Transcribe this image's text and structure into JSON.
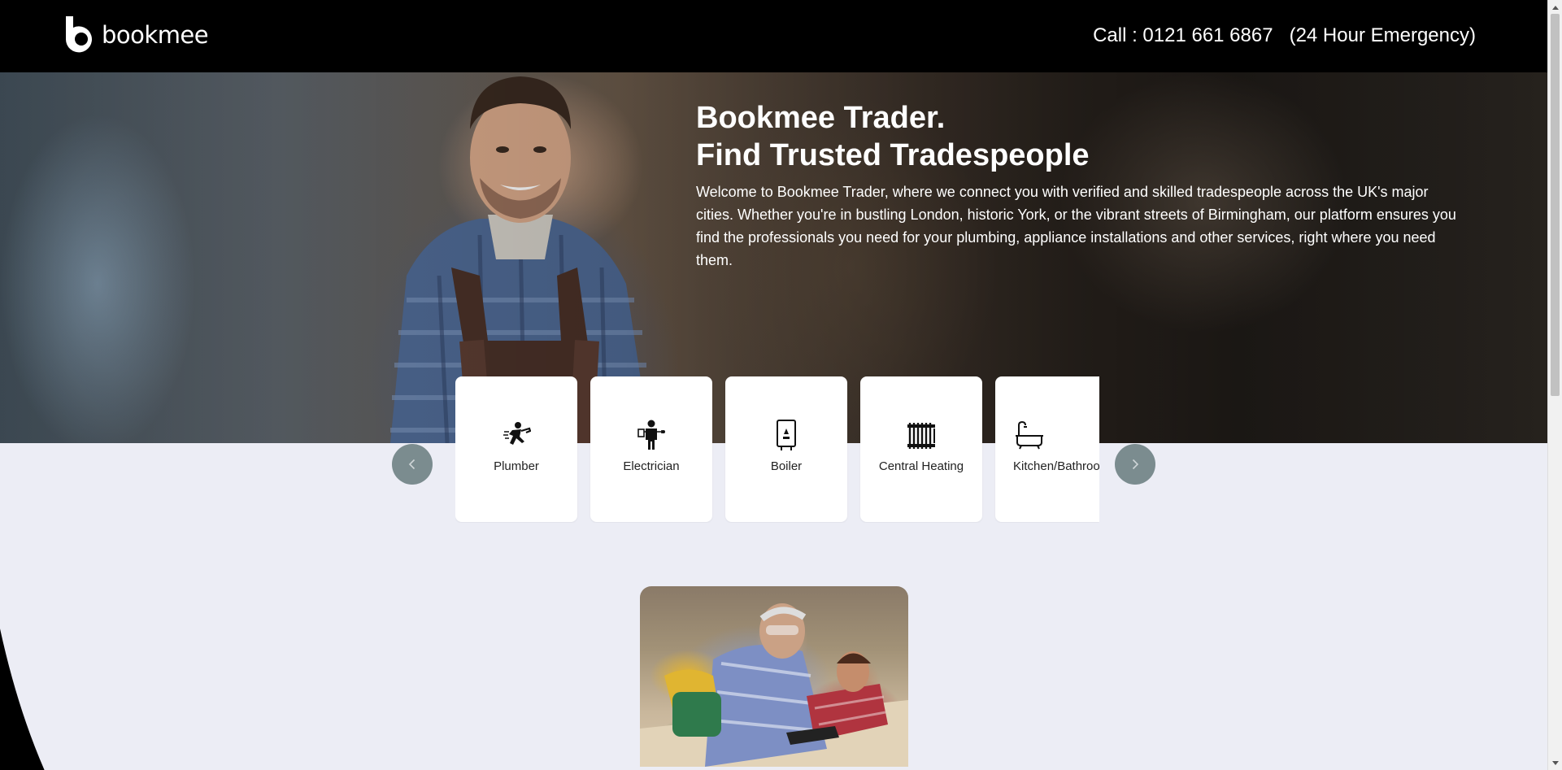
{
  "header": {
    "logo_text": "bookmee",
    "phone_label": "Call : 0121 661 6867",
    "phone_note": "(24 Hour Emergency)"
  },
  "hero": {
    "title_line1": "Bookmee Trader.",
    "title_line2": "Find Trusted Tradespeople",
    "description": "Welcome to Bookmee Trader, where we connect you with verified and skilled tradespeople across the UK's major cities. Whether you're in bustling London, historic York, or the vibrant streets of Birmingham, our platform ensures you find the professionals you need for your plumbing, appliance installations and other services, right where you need them."
  },
  "services": [
    {
      "label": "Plumber",
      "icon": "plumber-icon"
    },
    {
      "label": "Electrician",
      "icon": "electrician-icon"
    },
    {
      "label": "Boiler",
      "icon": "boiler-icon"
    },
    {
      "label": "Central Heating",
      "icon": "radiator-icon"
    },
    {
      "label": "Kitchen/Bathroom",
      "icon": "bathtub-icon"
    }
  ],
  "colors": {
    "header_bg": "#000000",
    "page_bg": "#ecedf5",
    "carousel_button": "#7b8c8f",
    "card_bg": "#ffffff"
  }
}
